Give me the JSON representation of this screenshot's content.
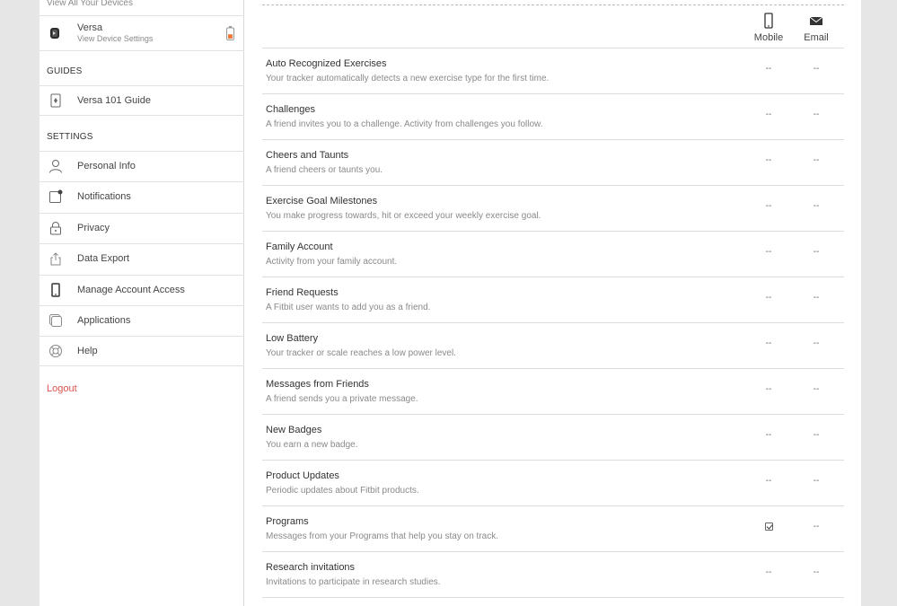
{
  "sidebar": {
    "view_all": "View All Your Devices",
    "device": {
      "name": "Versa",
      "sub": "View Device Settings",
      "battery_level": 0.4
    },
    "guides_head": "GUIDES",
    "guides": [
      {
        "label": "Versa 101 Guide",
        "icon": "guide-icon"
      }
    ],
    "settings_head": "SETTINGS",
    "items": [
      {
        "label": "Personal Info",
        "icon": "person-icon"
      },
      {
        "label": "Notifications",
        "icon": "notification-icon"
      },
      {
        "label": "Privacy",
        "icon": "lock-icon"
      },
      {
        "label": "Data Export",
        "icon": "export-icon"
      },
      {
        "label": "Manage Account Access",
        "icon": "phone-icon"
      },
      {
        "label": "Applications",
        "icon": "applications-icon"
      },
      {
        "label": "Help",
        "icon": "lifebuoy-icon"
      }
    ],
    "logout": "Logout"
  },
  "main": {
    "columns": {
      "mobile": "Mobile",
      "email": "Email"
    },
    "rows": [
      {
        "title": "Auto Recognized Exercises",
        "desc": "Your tracker automatically detects a new exercise type for the first time.",
        "mobile": "--",
        "email": "--"
      },
      {
        "title": "Challenges",
        "desc": "A friend invites you to a challenge. Activity from challenges you follow.",
        "mobile": "--",
        "email": "--"
      },
      {
        "title": "Cheers and Taunts",
        "desc": "A friend cheers or taunts you.",
        "mobile": "--",
        "email": "--"
      },
      {
        "title": "Exercise Goal Milestones",
        "desc": "You make progress towards, hit or exceed your weekly exercise goal.",
        "mobile": "--",
        "email": "--"
      },
      {
        "title": "Family Account",
        "desc": "Activity from your family account.",
        "mobile": "--",
        "email": "--"
      },
      {
        "title": "Friend Requests",
        "desc": "A Fitbit user wants to add you as a friend.",
        "mobile": "--",
        "email": "--"
      },
      {
        "title": "Low Battery",
        "desc": "Your tracker or scale reaches a low power level.",
        "mobile": "--",
        "email": "--"
      },
      {
        "title": "Messages from Friends",
        "desc": "A friend sends you a private message.",
        "mobile": "--",
        "email": "--"
      },
      {
        "title": "New Badges",
        "desc": "You earn a new badge.",
        "mobile": "--",
        "email": "--"
      },
      {
        "title": "Product Updates",
        "desc": "Periodic updates about Fitbit products.",
        "mobile": "--",
        "email": "--"
      },
      {
        "title": "Programs",
        "desc": "Messages from your Programs that help you stay on track.",
        "mobile": "checked",
        "email": "--"
      },
      {
        "title": "Research invitations",
        "desc": "Invitations to participate in research studies.",
        "mobile": "--",
        "email": "--"
      }
    ]
  },
  "colors": {
    "logout": "#d9534f",
    "battery": "#f07a3a",
    "page_bg": "#e6e6e6"
  }
}
